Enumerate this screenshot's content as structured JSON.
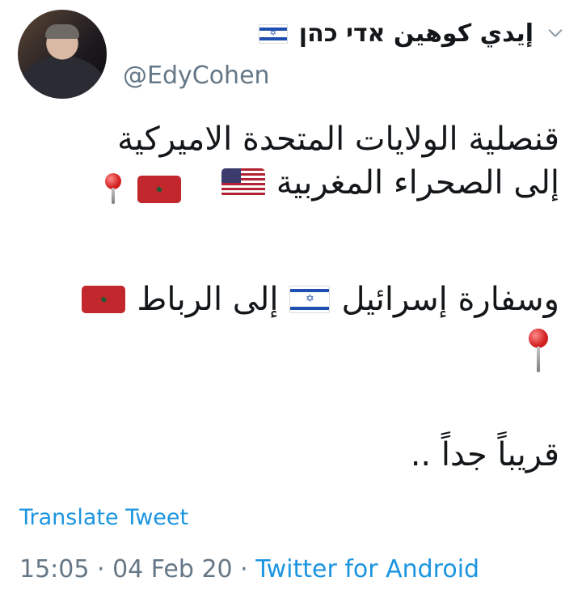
{
  "user": {
    "display_name": "إيدي كوهين אדי כהן",
    "handle": "@EdyCohen"
  },
  "tweet": {
    "line1": "قنصلية الولايات المتحدة الاميركية",
    "line2": "إلى الصحراء المغربية",
    "line3": "وسفارة إسرائيل",
    "line3b": "إلى الرباط",
    "line4": "قريباً جداً .."
  },
  "translate_label": "Translate Tweet",
  "meta": {
    "time": "15:05",
    "separator1": " · ",
    "date": "04 Feb 20",
    "separator2": " · ",
    "source": "Twitter for Android"
  },
  "icons": {
    "flags": [
      "israel-flag",
      "usa-flag",
      "morocco-flag"
    ],
    "pin": "round-pushpin",
    "menu": "chevron-down"
  },
  "colors": {
    "link": "#1b95e0",
    "muted": "#657786",
    "text": "#14171a"
  }
}
